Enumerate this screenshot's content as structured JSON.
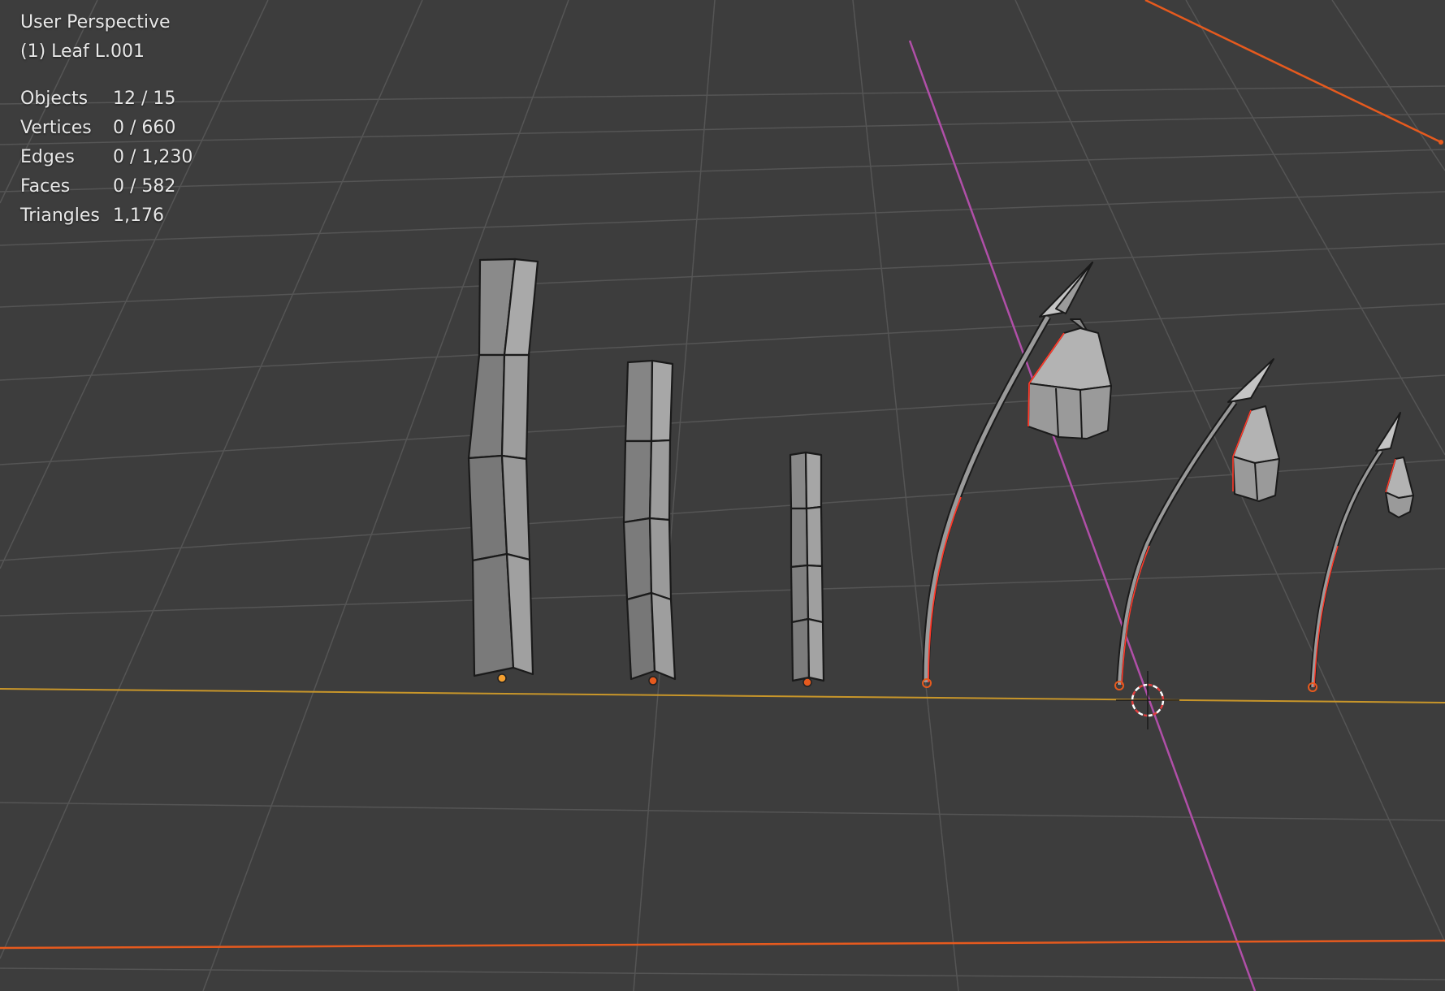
{
  "viewport": {
    "view_name": "User Perspective",
    "active_object": "(1) Leaf L.001"
  },
  "stats": [
    {
      "label": "Objects",
      "value": "12 / 15"
    },
    {
      "label": "Vertices",
      "value": "0 / 660"
    },
    {
      "label": "Edges",
      "value": "0 / 1,230"
    },
    {
      "label": "Faces",
      "value": "0 / 582"
    },
    {
      "label": "Triangles",
      "value": "1,176"
    }
  ],
  "colors": {
    "background": "#3d3d3d",
    "grid": "#555555",
    "x_axis": "#c8962a",
    "y_axis": "#b04fa8",
    "selection_outline": "#e65a1e",
    "active_outline": "#ff3a2a",
    "mesh_face": "#8f8f8f",
    "text": "#e8e8e8"
  }
}
